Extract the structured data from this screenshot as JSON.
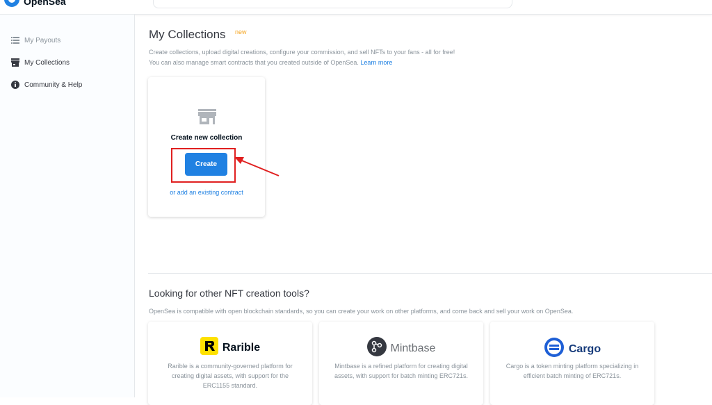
{
  "header": {
    "brand": "OpenSea"
  },
  "sidebar": {
    "items": [
      {
        "label": "My Payouts",
        "icon": "list-icon"
      },
      {
        "label": "My Collections",
        "icon": "store-icon"
      },
      {
        "label": "Community & Help",
        "icon": "info-icon"
      }
    ]
  },
  "main": {
    "title": "My Collections",
    "new_badge": "new",
    "desc_line1": "Create collections, upload digital creations, configure your commission, and sell NFTs to your fans - all for free!",
    "desc_line2": "You can also manage smart contracts that you created outside of OpenSea.",
    "learn_more": "Learn more",
    "card": {
      "title": "Create new collection",
      "create_label": "Create",
      "existing_link": "or add an existing contract"
    }
  },
  "tools": {
    "heading": "Looking for other NFT creation tools?",
    "description": "OpenSea is compatible with open blockchain standards, so you can create your work on other platforms, and come back and sell your work on OpenSea.",
    "items": [
      {
        "name": "Rarible",
        "desc": "Rarible is a community-governed platform for creating digital assets, with support for the ERC1155 standard.",
        "icon": "rarible-logo-icon"
      },
      {
        "name": "Mintbase",
        "desc": "Mintbase is a refined platform for creating digital assets, with support for batch minting ERC721s.",
        "icon": "mintbase-logo-icon"
      },
      {
        "name": "Cargo",
        "desc": "Cargo is a token minting platform specializing in efficient batch minting of ERC721s.",
        "icon": "cargo-logo-icon"
      }
    ]
  },
  "colors": {
    "accent": "#2081e2",
    "highlight": "#e02020",
    "new_badge": "#f5a623"
  }
}
